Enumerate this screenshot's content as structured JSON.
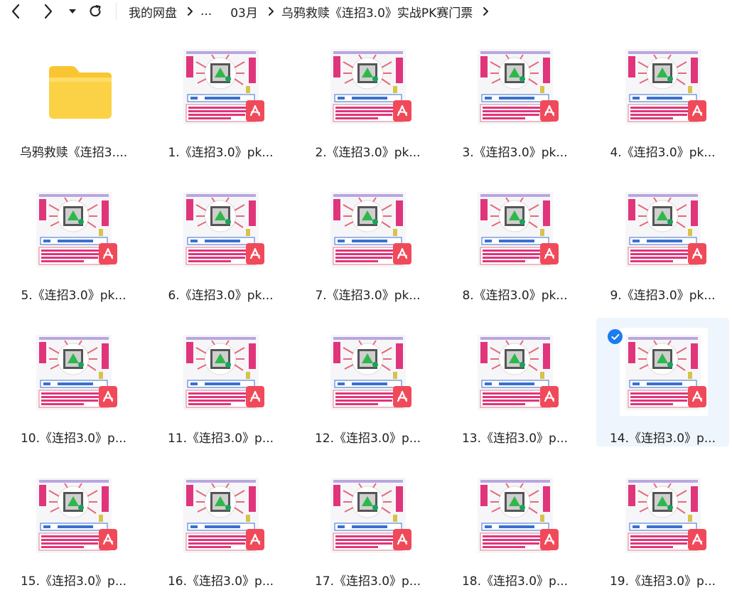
{
  "toolbar": {
    "back_icon": "chevron-left-icon",
    "forward_icon": "chevron-right-icon",
    "history_icon": "caret-down-icon",
    "refresh_icon": "refresh-icon"
  },
  "breadcrumb": {
    "root": "我的网盘",
    "ellipsis": "...",
    "parent": "03月",
    "current": "乌鸦救赎《连招3.0》实战PK赛门票"
  },
  "colors": {
    "accent": "#1a7cf0",
    "pdf_badge": "#f04a5a",
    "folder": "#f9c531",
    "selected_bg": "#eef5fd"
  },
  "items": [
    {
      "type": "folder",
      "label": "乌鸦救赎《连招3...."
    },
    {
      "type": "pdf",
      "label": "1.《连招3.0》pk..."
    },
    {
      "type": "pdf",
      "label": "2.《连招3.0》pk..."
    },
    {
      "type": "pdf",
      "label": "3.《连招3.0》pk..."
    },
    {
      "type": "pdf",
      "label": "4.《连招3.0》pk..."
    },
    {
      "type": "pdf",
      "label": "5.《连招3.0》pk..."
    },
    {
      "type": "pdf",
      "label": "6.《连招3.0》pk..."
    },
    {
      "type": "pdf",
      "label": "7.《连招3.0》pk..."
    },
    {
      "type": "pdf",
      "label": "8.《连招3.0》pk..."
    },
    {
      "type": "pdf",
      "label": "9.《连招3.0》pk..."
    },
    {
      "type": "pdf",
      "label": "10.《连招3.0》p..."
    },
    {
      "type": "pdf",
      "label": "11.《连招3.0》p..."
    },
    {
      "type": "pdf",
      "label": "12.《连招3.0》p..."
    },
    {
      "type": "pdf",
      "label": "13.《连招3.0》p..."
    },
    {
      "type": "pdf",
      "label": "14.《连招3.0》p...",
      "selected": true
    },
    {
      "type": "pdf",
      "label": "15.《连招3.0》p..."
    },
    {
      "type": "pdf",
      "label": "16.《连招3.0》p..."
    },
    {
      "type": "pdf",
      "label": "17.《连招3.0》p..."
    },
    {
      "type": "pdf",
      "label": "18.《连招3.0》p..."
    },
    {
      "type": "pdf",
      "label": "19.《连招3.0》p..."
    }
  ]
}
